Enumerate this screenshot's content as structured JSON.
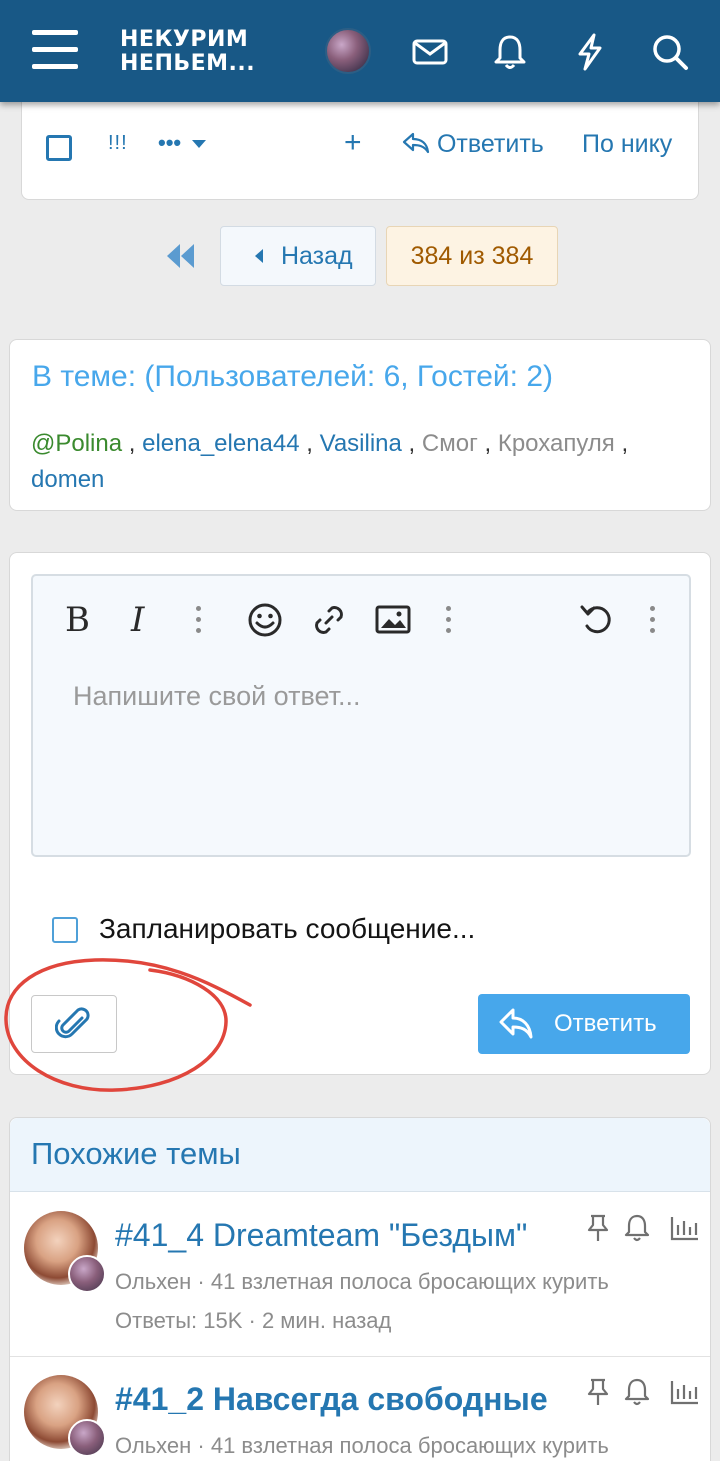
{
  "header": {
    "logo_line1": "НЕКУРИМ",
    "logo_line2": "НЕПЬЕМ...",
    "bg_color": "#185886"
  },
  "toolbar": {
    "exclaim_label": "!!!",
    "more_label": "•••",
    "add_label": "+",
    "reply_label": "Ответить",
    "by_nick_label": "По нику"
  },
  "pagination": {
    "back_label": "Назад",
    "current_label": "384 из 384"
  },
  "online": {
    "title": "В теме: (Пользователей: 6, Гостей: 2)",
    "users": [
      "@Polina",
      "elena_elena44",
      "Vasilina",
      "Смог",
      "Крохапуля",
      "domen"
    ],
    "separator": ","
  },
  "editor": {
    "bold_label": "B",
    "italic_label": "I",
    "placeholder": "Напишите свой ответ...",
    "schedule_label": "Запланировать сообщение...",
    "reply_button": "Ответить"
  },
  "similar": {
    "title": "Похожие темы",
    "threads": [
      {
        "title": "#41_4 Dreamteam \"Бездым\"",
        "subtitle": "Ольхен · 41 взлетная полоса бросающих курить",
        "meta": "Ответы: 15K · 2 мин. назад"
      },
      {
        "title": "#41_2 Навсегда свободные",
        "subtitle": "Ольхен · 41 взлетная полоса бросающих курить",
        "meta": ""
      }
    ]
  },
  "colors": {
    "accent": "#2577b1",
    "link_light": "#47a7eb",
    "annotation_red": "#e0463c"
  }
}
